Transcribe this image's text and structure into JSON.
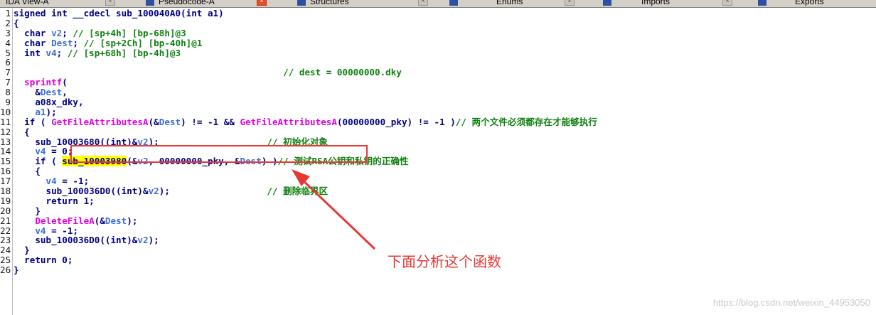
{
  "tabs": [
    {
      "label": "IDA View-A",
      "active": false
    },
    {
      "label": "Pseudocode-A",
      "active": true
    },
    {
      "label": "Structures",
      "active": false
    },
    {
      "label": "Enums",
      "active": false
    },
    {
      "label": "Imports",
      "active": false
    },
    {
      "label": "Exports",
      "active": false
    }
  ],
  "code": {
    "lines": [
      {
        "n": "1",
        "segs": [
          [
            "kw",
            "signed int __cdecl sub_100040A0(int a1)"
          ]
        ]
      },
      {
        "n": "2",
        "segs": [
          [
            "op",
            "{"
          ]
        ]
      },
      {
        "n": "3",
        "segs": [
          [
            "kw",
            "  char "
          ],
          [
            "var",
            "v2"
          ],
          [
            "op",
            "; "
          ],
          [
            "cm",
            "// [sp+4h] [bp-68h]@3"
          ]
        ]
      },
      {
        "n": "4",
        "segs": [
          [
            "kw",
            "  char "
          ],
          [
            "var",
            "Dest"
          ],
          [
            "op",
            "; "
          ],
          [
            "cm",
            "// [sp+2Ch] [bp-40h]@1"
          ]
        ]
      },
      {
        "n": "5",
        "segs": [
          [
            "kw",
            "  int "
          ],
          [
            "var",
            "v4"
          ],
          [
            "op",
            "; "
          ],
          [
            "cm",
            "// [sp+68h] [bp-4h]@3"
          ]
        ]
      },
      {
        "n": "6",
        "segs": [
          [
            "op",
            ""
          ]
        ]
      },
      {
        "n": "7",
        "segs": [
          [
            "op",
            "                                                  "
          ],
          [
            "cm",
            "// dest = 00000000.dky"
          ]
        ]
      },
      {
        "n": "7",
        "segs": [
          [
            "fn",
            "  sprintf"
          ],
          [
            "op",
            "("
          ]
        ]
      },
      {
        "n": "8",
        "segs": [
          [
            "op",
            "    &"
          ],
          [
            "var",
            "Dest"
          ],
          [
            "op",
            ","
          ]
        ]
      },
      {
        "n": "9",
        "segs": [
          [
            "op",
            "    a08x_dky,"
          ]
        ]
      },
      {
        "n": "10",
        "segs": [
          [
            "var",
            "    a1"
          ],
          [
            "op",
            ");"
          ]
        ]
      },
      {
        "n": "11",
        "segs": [
          [
            "kw",
            "  if ( "
          ],
          [
            "fn",
            "GetFileAttributesA"
          ],
          [
            "op",
            "(&"
          ],
          [
            "var",
            "Dest"
          ],
          [
            "op",
            ") != -1 && "
          ],
          [
            "fn",
            "GetFileAttributesA"
          ],
          [
            "op",
            "(00000000_pky) != -1 )"
          ],
          [
            "cm",
            "// 两个文件必须都存在才能够执行"
          ]
        ]
      },
      {
        "n": "12",
        "segs": [
          [
            "op",
            "  {"
          ]
        ]
      },
      {
        "n": "13",
        "segs": [
          [
            "op",
            "    sub_10003680((int)&"
          ],
          [
            "var",
            "v2"
          ],
          [
            "op",
            ");                    "
          ],
          [
            "cm",
            "// 初始化对象"
          ]
        ]
      },
      {
        "n": "14",
        "segs": [
          [
            "var",
            "    v4"
          ],
          [
            "op",
            " = 0;"
          ]
        ]
      },
      {
        "n": "15",
        "segs": [
          [
            "kw",
            "    if ( "
          ],
          [
            "hl",
            "sub_10003980"
          ],
          [
            "op",
            "(&"
          ],
          [
            "var",
            "v2"
          ],
          [
            "op",
            ", 00000000_pky, &"
          ],
          [
            "var",
            "Dest"
          ],
          [
            "op",
            ") )"
          ],
          [
            "cm",
            "// 测试RSA公钥和私钥的正确性"
          ]
        ]
      },
      {
        "n": "16",
        "segs": [
          [
            "op",
            "    {"
          ]
        ]
      },
      {
        "n": "17",
        "segs": [
          [
            "var",
            "      v4"
          ],
          [
            "op",
            " = -1;"
          ]
        ]
      },
      {
        "n": "18",
        "segs": [
          [
            "op",
            "      sub_100036D0((int)&"
          ],
          [
            "var",
            "v2"
          ],
          [
            "op",
            ");                  "
          ],
          [
            "cm",
            "// 删除临界区"
          ]
        ]
      },
      {
        "n": "19",
        "segs": [
          [
            "kw",
            "      return 1;"
          ]
        ]
      },
      {
        "n": "20",
        "segs": [
          [
            "op",
            "    }"
          ]
        ]
      },
      {
        "n": "21",
        "segs": [
          [
            "fn",
            "    DeleteFileA"
          ],
          [
            "op",
            "(&"
          ],
          [
            "var",
            "Dest"
          ],
          [
            "op",
            ");"
          ]
        ]
      },
      {
        "n": "22",
        "segs": [
          [
            "var",
            "    v4"
          ],
          [
            "op",
            " = -1;"
          ]
        ]
      },
      {
        "n": "23",
        "segs": [
          [
            "op",
            "    sub_100036D0((int)&"
          ],
          [
            "var",
            "v2"
          ],
          [
            "op",
            ");"
          ]
        ]
      },
      {
        "n": "24",
        "segs": [
          [
            "op",
            "  }"
          ]
        ]
      },
      {
        "n": "25",
        "segs": [
          [
            "kw",
            "  return 0;"
          ]
        ]
      },
      {
        "n": "26",
        "segs": [
          [
            "op",
            "}"
          ]
        ]
      }
    ]
  },
  "annotation": {
    "text": "下面分析这个函数"
  },
  "watermark": {
    "text": "https://blog.csdn.net/weixin_44953050"
  },
  "colors": {
    "highlight": "#ffff00",
    "annotation_red": "#e53935",
    "comment_green": "#108010",
    "api_magenta": "#e000e0"
  }
}
